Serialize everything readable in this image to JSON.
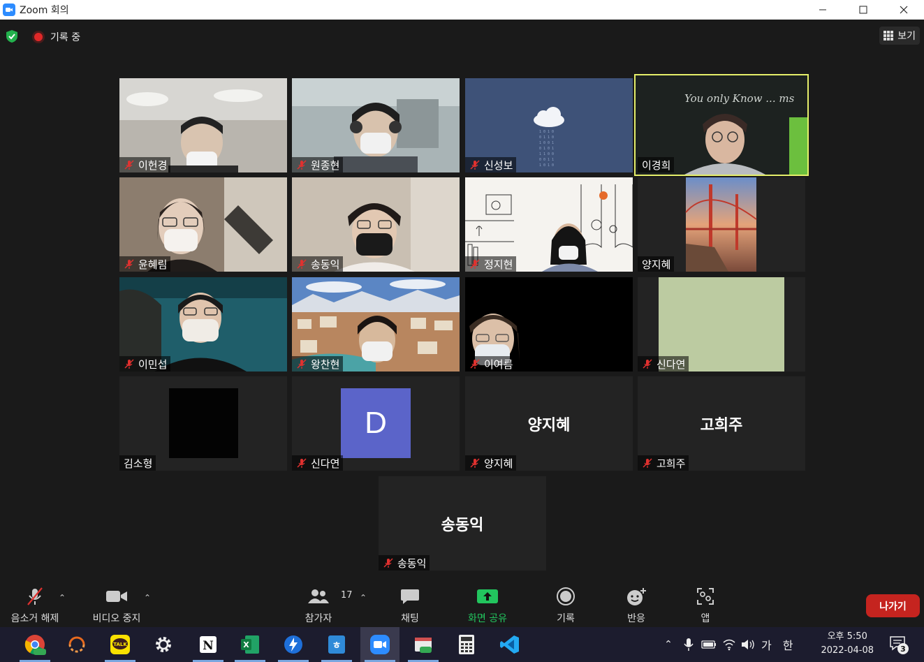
{
  "window": {
    "title": "Zoom 회의"
  },
  "topbar": {
    "recording_label": "기록 중",
    "view_label": "보기"
  },
  "participants": {
    "p1": "이헌경",
    "p2": "원종현",
    "p3": "신성보",
    "p4": "이경희",
    "p5": "윤혜림",
    "p6": "송동익",
    "p7": "정지현",
    "p8": "양지혜",
    "p9": "이민섭",
    "p10": "왕찬현",
    "p11": "이여름",
    "p12": "신다연",
    "p13": "김소형",
    "p14": "신다연",
    "p15": "양지혜",
    "p16": "고희주",
    "p17": "송동익"
  },
  "avatar_letter": "D",
  "big_names": {
    "p15": "양지혜",
    "p16": "고희주",
    "p17": "송동익"
  },
  "whiteboard_text": "You only Know ... ms",
  "toolbar": {
    "unmute": "음소거 해제",
    "stop_video": "비디오 중지",
    "participants": "참가자",
    "participants_count": "17",
    "chat": "채팅",
    "share_screen": "화면 공유",
    "record": "기록",
    "reactions": "반응",
    "apps": "앱",
    "leave": "나가기"
  },
  "taskbar": {
    "ime_mode": "가",
    "ime_lang": "한",
    "time": "오후 5:50",
    "date": "2022-04-08",
    "notifications": "3"
  },
  "colors": {
    "active_speaker": "#e5ef6a",
    "share_green": "#22c55e",
    "leave_red": "#c5241f",
    "avatar_purple": "#5b64c9",
    "mute_red": "#e0312f"
  }
}
